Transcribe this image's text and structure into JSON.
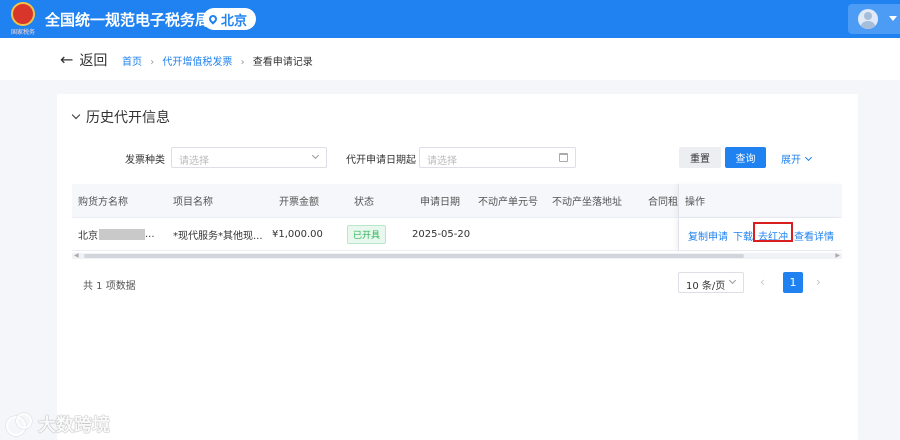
{
  "header": {
    "emblem_subtext": "国家税务",
    "site_title": "全国统一规范电子税务局",
    "region": "北京"
  },
  "nav": {
    "back_label": "返回",
    "breadcrumb": [
      "首页",
      "代开增值税发票",
      "查看申请记录"
    ]
  },
  "section": {
    "title": "历史代开信息"
  },
  "filters": {
    "invoice_type_label": "发票种类",
    "invoice_type_placeholder": "请选择",
    "apply_date_label": "代开申请日期起",
    "apply_date_placeholder": "请选择",
    "reset_label": "重置",
    "query_label": "查询",
    "expand_label": "展开"
  },
  "table": {
    "columns": [
      "购货方名称",
      "项目名称",
      "开票金额",
      "状态",
      "申请日期",
      "不动产单元号",
      "不动产坐落地址",
      "合同租赁",
      "操作"
    ],
    "rows": [
      {
        "buyer": "北京",
        "buyer_suffix": "...",
        "item": "*现代服务*其他现...",
        "amount": "¥1,000.00",
        "status": "已开具",
        "date": "2025-05-20",
        "actions": [
          "复制申请",
          "下载",
          "去红冲",
          "查看详情"
        ]
      }
    ]
  },
  "pagination": {
    "total": "共 1 项数据",
    "page_size": "10 条/页",
    "current_page": "1"
  },
  "watermark": {
    "text": "大数跨境"
  }
}
